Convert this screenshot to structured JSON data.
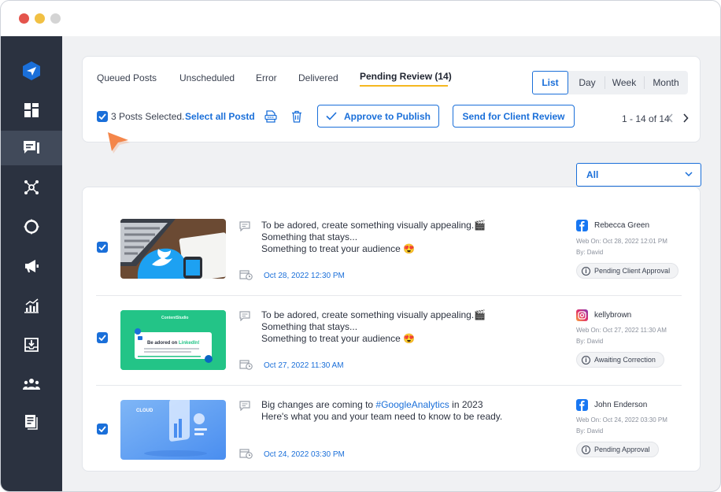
{
  "window": {
    "controls": [
      "close",
      "minimize",
      "maximize"
    ]
  },
  "sidebar": {
    "items": [
      {
        "icon": "send-icon",
        "active": false
      },
      {
        "icon": "dashboard-icon",
        "active": false
      },
      {
        "icon": "posts-icon",
        "active": true
      },
      {
        "icon": "network-icon",
        "active": false
      },
      {
        "icon": "lifebuoy-icon",
        "active": false
      },
      {
        "icon": "megaphone-icon",
        "active": false
      },
      {
        "icon": "analytics-icon",
        "active": false
      },
      {
        "icon": "inbox-icon",
        "active": false
      },
      {
        "icon": "users-icon",
        "active": false
      },
      {
        "icon": "reports-icon",
        "active": false
      }
    ]
  },
  "tabs": [
    {
      "label": "Queued Posts"
    },
    {
      "label": "Unscheduled"
    },
    {
      "label": "Error"
    },
    {
      "label": "Delivered"
    },
    {
      "label": "Pending Review (14)",
      "active": true
    }
  ],
  "view_toggle": {
    "list": "List",
    "day": "Day",
    "week": "Week",
    "month": "Month",
    "selected": "List"
  },
  "selection": {
    "text": "3 Posts Selected.",
    "select_all": "Select all Postd"
  },
  "actions": {
    "approve": "Approve to Publish",
    "client_review": "Send for Client Review"
  },
  "pager": {
    "text": "1 - 14 of 14"
  },
  "filter": {
    "value": "All"
  },
  "posts": [
    {
      "caption": [
        "To be adored, create something visually appealing.🎬",
        "Something that stays...",
        "Something to treat your audience 😍"
      ],
      "date": "Oct 28, 2022 12:30 PM",
      "account": {
        "network": "facebook",
        "name": "Rebecca Green"
      },
      "web_on": "Web On: Oct 28, 2022 12:01 PM",
      "by": "By: David",
      "status": "Pending Client Approval"
    },
    {
      "caption": [
        "To be adored, create something visually appealing.🎬",
        "Something that stays...",
        "Something to treat your audience 😍"
      ],
      "date": "Oct 27, 2022 11:30 AM",
      "account": {
        "network": "instagram",
        "name": "kellybrown"
      },
      "web_on": "Web On: Oct 27, 2022 11:30 AM",
      "by": "By: David",
      "status": "Awaiting Correction"
    },
    {
      "caption_pre": "Big changes are coming to ",
      "caption_hashtag": "#GoogleAnalytics",
      "caption_post": " in 2023",
      "caption_line2": "Here's what you and your team need to know to be ready.",
      "date": "Oct 24, 2022 03:30 PM",
      "account": {
        "network": "facebook",
        "name": "John Enderson"
      },
      "web_on": "Web On: Oct 24, 2022 03:30 PM",
      "by": "By: David",
      "status": "Pending Approval"
    }
  ],
  "thumb2": {
    "brand": "ContentStudio",
    "headline_pre": "Be adored on ",
    "headline_net": "LinkedIn!"
  },
  "thumb3": {
    "label": "CLOUD"
  },
  "colors": {
    "accent": "#1a6fd9",
    "sidebar": "#2b3240",
    "tab_underline": "#f5b820",
    "cursor": "#f4864a"
  }
}
